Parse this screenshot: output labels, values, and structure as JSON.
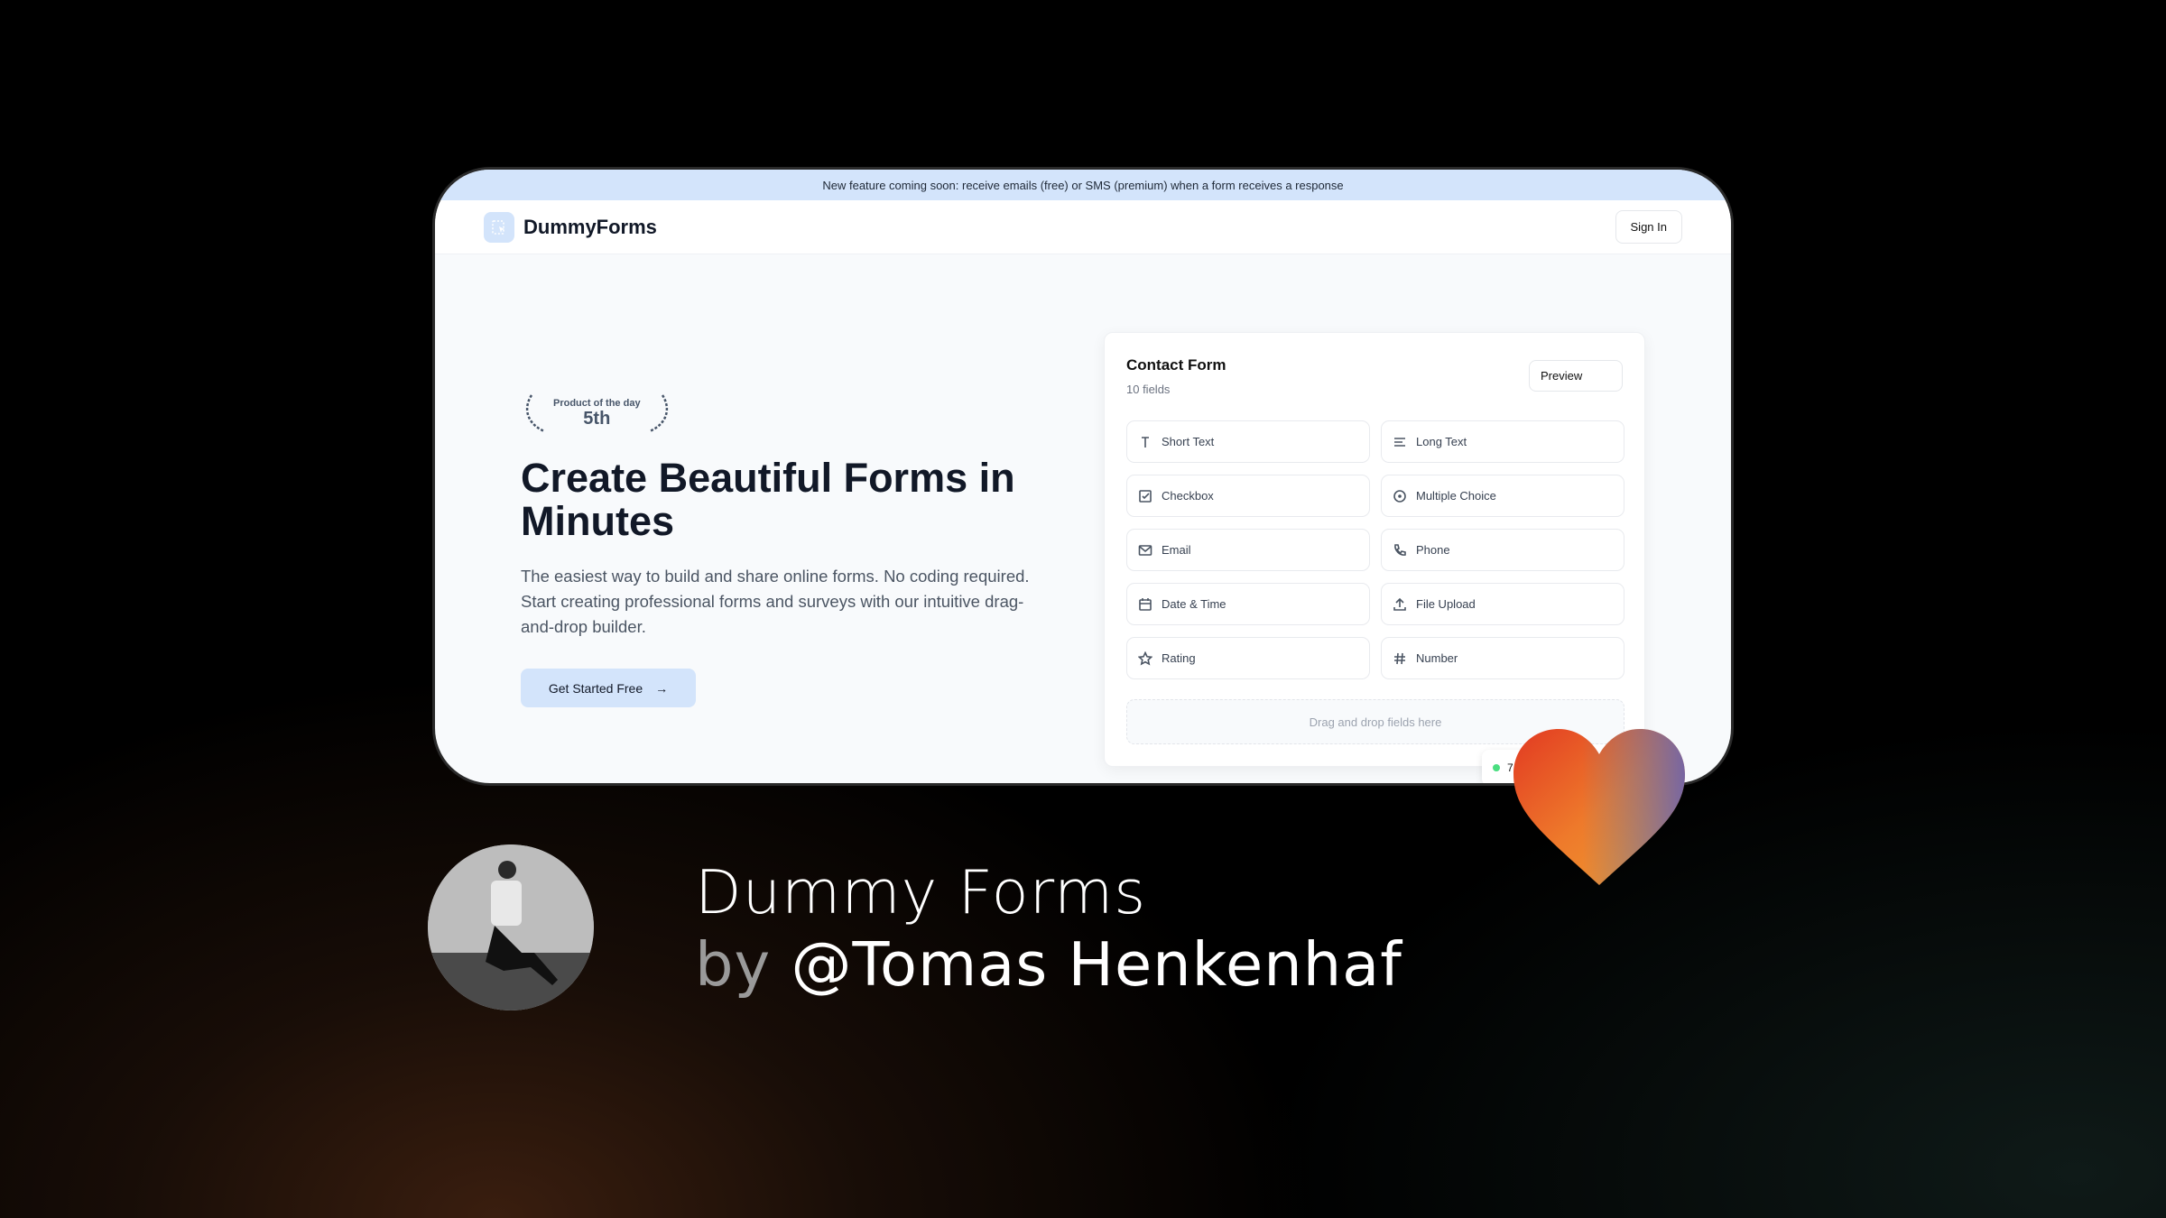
{
  "banner": {
    "text": "New feature coming soon: receive emails (free) or SMS (premium) when a form receives a response"
  },
  "nav": {
    "logo": "DummyForms",
    "sign_in": "Sign In"
  },
  "hero": {
    "badge_small": "Product of the day",
    "badge_rank": "5th",
    "headline": "Create Beautiful Forms in Minutes",
    "description": "The easiest way to build and share online forms. No coding required. Start creating professional forms and surveys with our intuitive drag-and-drop builder.",
    "cta": "Get Started Free"
  },
  "form": {
    "title": "Contact Form",
    "subtitle": "10 fields",
    "preview": "Preview",
    "drop_hint": "Drag and drop fields here",
    "fields": [
      {
        "label": "Short Text",
        "icon": "type-icon"
      },
      {
        "label": "Long Text",
        "icon": "align-left-icon"
      },
      {
        "label": "Checkbox",
        "icon": "checkbox-icon"
      },
      {
        "label": "Multiple Choice",
        "icon": "radio-icon"
      },
      {
        "label": "Email",
        "icon": "mail-icon"
      },
      {
        "label": "Phone",
        "icon": "phone-icon"
      },
      {
        "label": "Date & Time",
        "icon": "calendar-icon"
      },
      {
        "label": "File Upload",
        "icon": "upload-icon"
      },
      {
        "label": "Rating",
        "icon": "star-icon"
      },
      {
        "label": "Number",
        "icon": "hash-icon"
      }
    ]
  },
  "status": {
    "text": "7"
  },
  "caption": {
    "title": "Dummy Forms",
    "by": "by",
    "author": "@Tomas Henkenhaf"
  },
  "colors": {
    "accent": "#d3e4fb",
    "text": "#111827"
  }
}
